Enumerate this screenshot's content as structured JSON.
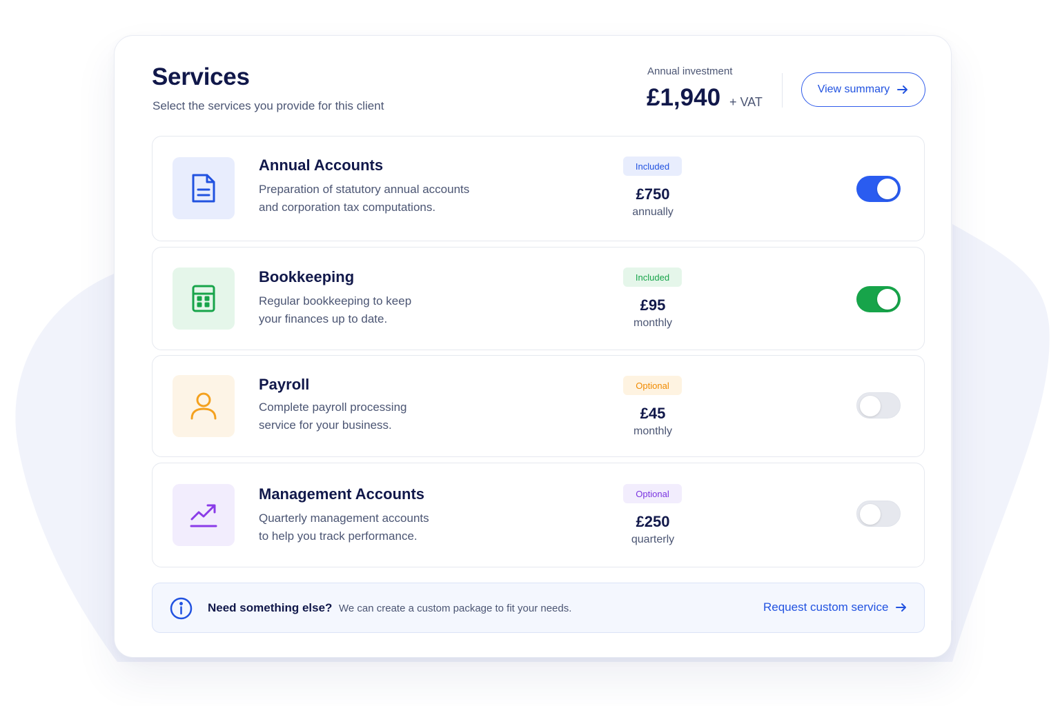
{
  "header": {
    "title": "Services",
    "subtitle": "Select the services you provide for this client"
  },
  "investment": {
    "label": "Annual investment",
    "amount": "£1,940",
    "vat": "+ VAT"
  },
  "view_summary": {
    "label": "View summary",
    "icon": "arrow-right-icon"
  },
  "services": [
    {
      "name": "Annual Accounts",
      "desc_line1": "Preparation of statutory annual accounts",
      "desc_line2": "and corporation tax computations.",
      "badge": "Included",
      "price": "£750",
      "period": "annually",
      "enabled": true,
      "icon": "document-icon"
    },
    {
      "name": "Bookkeeping",
      "desc_line1": "Regular bookkeeping to keep",
      "desc_line2": "your finances up to date.",
      "badge": "Included",
      "price": "£95",
      "period": "monthly",
      "enabled": true,
      "icon": "calculator-icon"
    },
    {
      "name": "Payroll",
      "desc_line1": "Complete payroll processing",
      "desc_line2": "service for your business.",
      "badge": "Optional",
      "price": "£45",
      "period": "monthly",
      "enabled": false,
      "icon": "user-icon"
    },
    {
      "name": "Management Accounts",
      "desc_line1": "Quarterly management accounts",
      "desc_line2": "to help you track performance.",
      "badge": "Optional",
      "price": "£250",
      "period": "quarterly",
      "enabled": false,
      "icon": "trend-up-icon"
    }
  ],
  "info": {
    "title": "Need something else?",
    "text": "We can create a custom package to fit your needs.",
    "link": "Request custom service",
    "icon": "info-icon"
  },
  "colors": {
    "primary": "#2152e0",
    "toggle_blue": "#2a5cf0",
    "toggle_green": "#17a44a",
    "text_dark": "#11184a",
    "text_muted": "#4b5573"
  }
}
